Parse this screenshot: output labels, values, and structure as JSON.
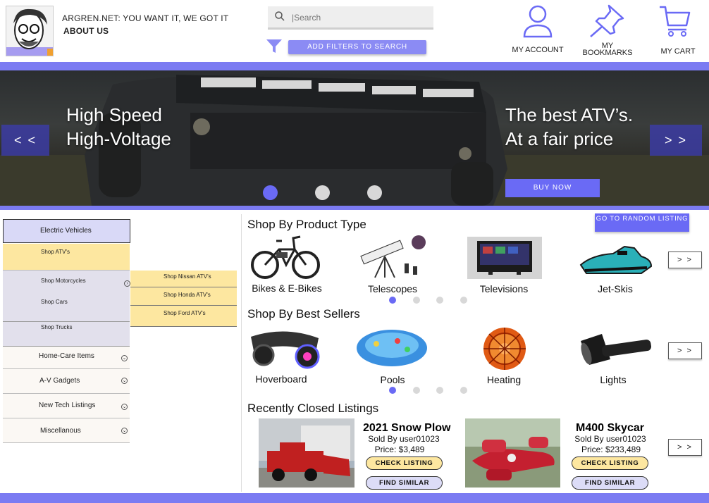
{
  "header": {
    "tagline": "ARGREN.NET: YOU WANT IT, WE GOT IT",
    "about": "ABOUT US",
    "search_placeholder": "|Search",
    "filter_button": "ADD FILTERS TO SEARCH",
    "account": "MY ACCOUNT",
    "bookmarks_line1": "MY",
    "bookmarks_line2": "BOOKMARKS",
    "cart": "MY CART"
  },
  "hero": {
    "left_line1": "High Speed",
    "left_line2": "High-Voltage",
    "right_line1": "The best ATV’s.",
    "right_line2": "At a fair price",
    "prev": "< <",
    "next": "> >",
    "buy_now": "BUY NOW",
    "active_slide": 1,
    "slide_count": 3
  },
  "sidebar": {
    "header": "Electric Vehicles",
    "items": [
      {
        "label": "Shop ATV's"
      },
      {
        "label": "Shop Motorcycles"
      },
      {
        "label": "Shop Cars"
      },
      {
        "label": "Shop Trucks"
      }
    ],
    "flyout": [
      {
        "label": "Shop Nissan ATV's"
      },
      {
        "label": "Shop Honda ATV's"
      },
      {
        "label": "Shop Ford ATV's"
      }
    ],
    "categories": [
      {
        "label": "Home-Care Items"
      },
      {
        "label": "A-V Gadgets"
      },
      {
        "label": "New Tech Listings"
      },
      {
        "label": "Miscellanous"
      }
    ]
  },
  "product_types": {
    "title": "Shop By Product Type",
    "random_button": "GO TO RANDOM LISTING",
    "items": [
      {
        "label": "Bikes & E-Bikes"
      },
      {
        "label": "Telescopes"
      },
      {
        "label": "Televisions"
      },
      {
        "label": "Jet-Skis"
      }
    ],
    "next": "> >"
  },
  "best_sellers": {
    "title": "Shop By Best Sellers",
    "items": [
      {
        "label": "Hoverboard"
      },
      {
        "label": "Pools"
      },
      {
        "label": "Heating"
      },
      {
        "label": "Lights"
      }
    ],
    "next": "> >"
  },
  "recent": {
    "title": "Recently Closed Listings",
    "next": "> >",
    "listings": [
      {
        "title": "2021 Snow Plow",
        "seller": "Sold By user01023",
        "price": "Price: $3,489",
        "check": "CHECK LISTING",
        "similar": "FIND SIMILAR"
      },
      {
        "title": "M400 Skycar",
        "seller": "Sold By user01023",
        "price": "Price: $233,489",
        "check": "CHECK LISTING",
        "similar": "FIND SIMILAR"
      }
    ]
  },
  "colors": {
    "accent": "#7b7bf2",
    "dot_active": "#6a6af5",
    "dot_inactive": "#d8d8d8",
    "yellow": "#fde7a0"
  }
}
